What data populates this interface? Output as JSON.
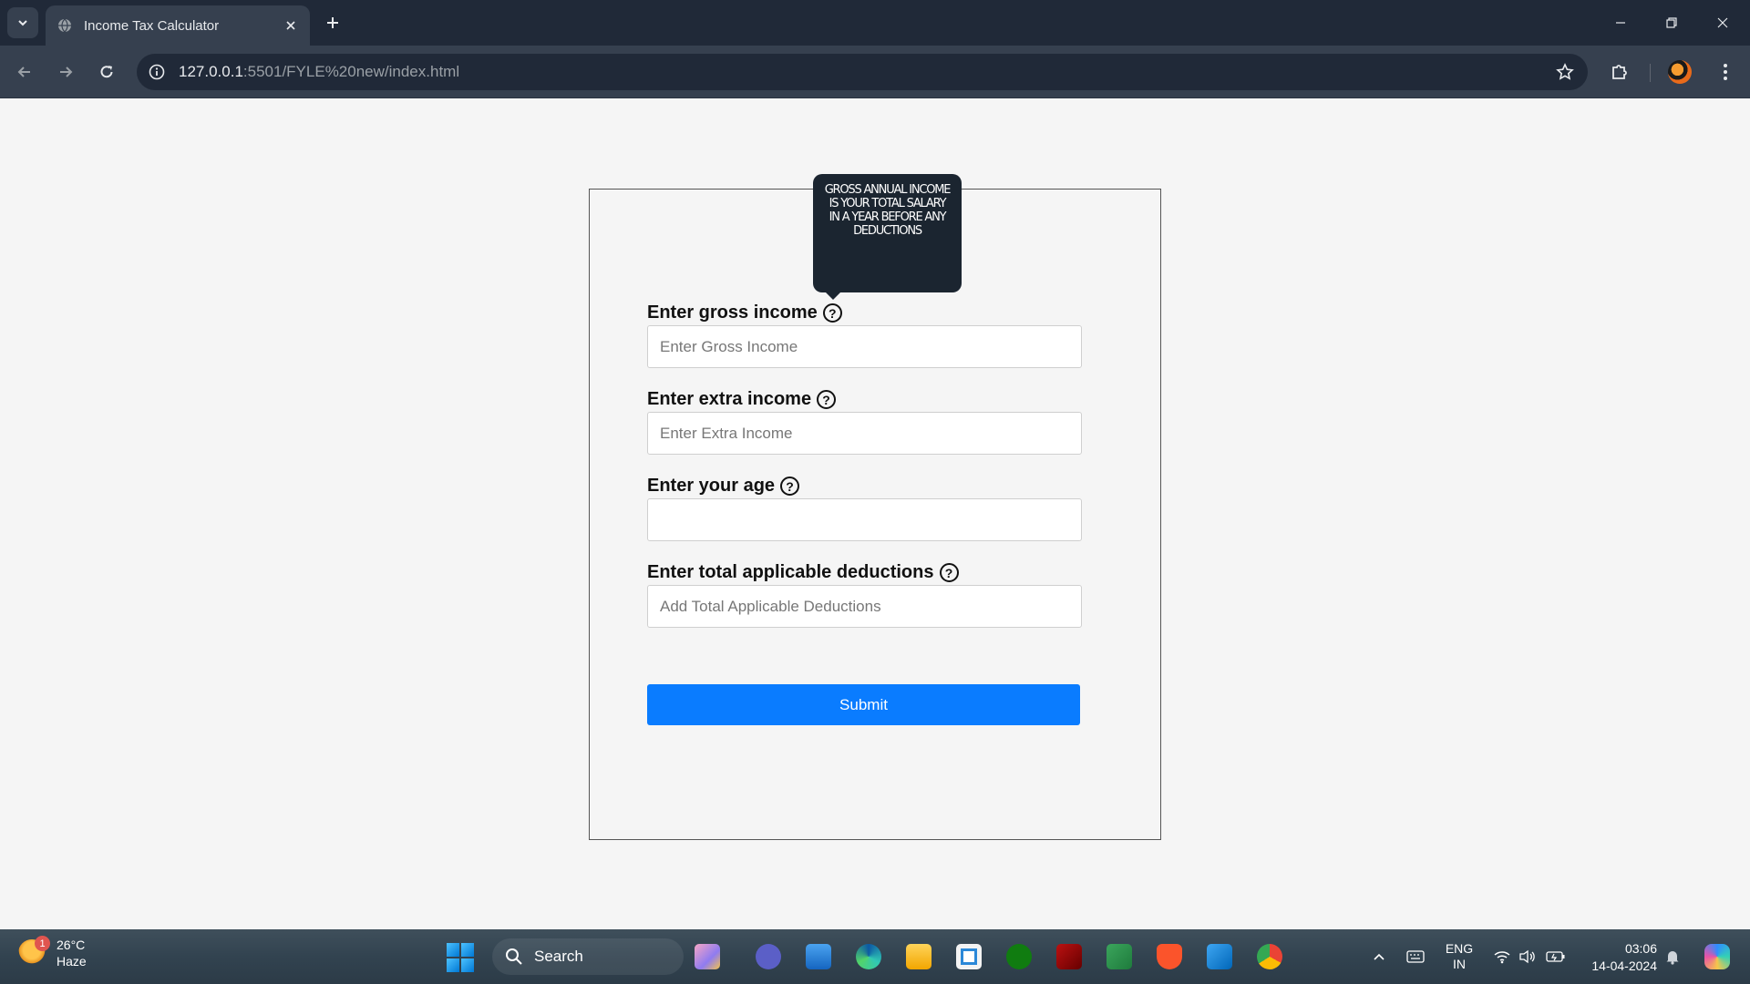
{
  "browser": {
    "tab_title": "Income Tax Calculator",
    "url_host": "127.0.0.1",
    "url_rest": ":5501/FYLE%20new/index.html"
  },
  "form": {
    "tooltip_text": "GROSS ANNUAL INCOME IS YOUR TOTAL SALARY IN A YEAR BEFORE ANY DEDUCTIONS",
    "fields": [
      {
        "label": "Enter gross income",
        "placeholder": "Enter Gross Income",
        "value": ""
      },
      {
        "label": "Enter extra income",
        "placeholder": "Enter Extra Income",
        "value": ""
      },
      {
        "label": "Enter your age",
        "placeholder": "",
        "value": ""
      },
      {
        "label": "Enter total applicable deductions",
        "placeholder": "Add Total Applicable Deductions",
        "value": ""
      }
    ],
    "help_glyph": "?",
    "submit_label": "Submit"
  },
  "taskbar": {
    "weather_temp": "26°C",
    "weather_cond": "Haze",
    "weather_badge": "1",
    "search_label": "Search",
    "lang_top": "ENG",
    "lang_bottom": "IN",
    "time": "03:06",
    "date": "14-04-2024"
  },
  "colors": {
    "submit": "#0a7cff",
    "tooltip_bg": "#1b2530",
    "tab_bar": "#202938",
    "toolbar": "#36404f"
  }
}
